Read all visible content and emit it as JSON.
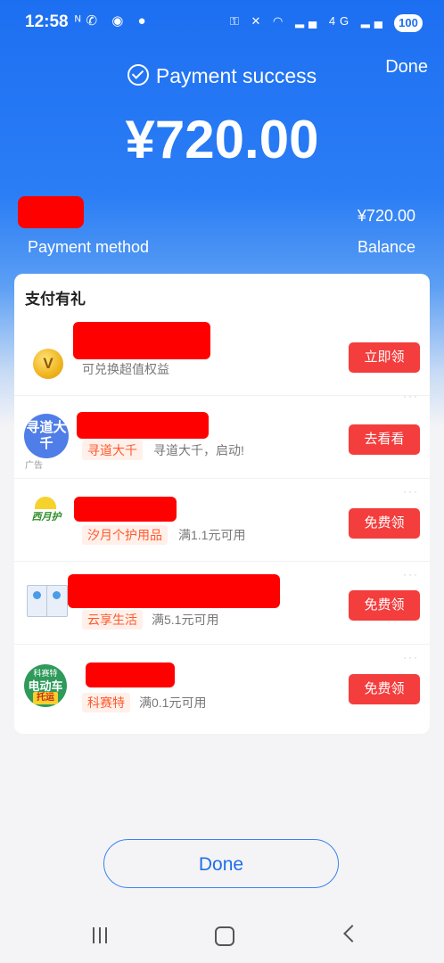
{
  "status_bar": {
    "time": "12:58",
    "left_icons": [
      "nfc-icon",
      "wechat-icon",
      "chat-icon",
      "dot-icon"
    ],
    "left_icons_glyph": "ᴺ✆ ◉ ●",
    "right_icons_glyph": "⚿ ✕ ◠ ▂▄ 4G ▂▄",
    "battery": "100"
  },
  "header": {
    "done_label": "Done",
    "success_text": "Payment success",
    "amount": "¥720.00",
    "balance_amount": "¥720.00",
    "payment_method_label": "Payment method",
    "balance_label": "Balance"
  },
  "card": {
    "title": "支付有礼",
    "items": [
      {
        "logo": "vip-coin-icon",
        "logo_text": "V",
        "tag": "",
        "desc": "可兑换超值权益",
        "button": "立即领"
      },
      {
        "logo": "xundao-daqian-logo",
        "logo_text": "寻道大千",
        "ad": "广告",
        "tag": "寻道大千",
        "desc": "寻道大千，启动!",
        "button": "去看看"
      },
      {
        "logo": "xiyue-logo",
        "logo_text": "西月护",
        "tag": "汐月个护用品",
        "desc": "满1.1元可用",
        "button": "免费领"
      },
      {
        "logo": "yunxiang-logo",
        "tag": "云享生活",
        "desc": "满5.1元可用",
        "button": "免费领"
      },
      {
        "logo": "kesaite-logo",
        "logo_l1": "科赛特",
        "logo_l2": "电动车",
        "logo_l3": "托运",
        "tag": "科赛特",
        "desc": "满0.1元可用",
        "button": "免费领"
      }
    ]
  },
  "footer": {
    "done_label": "Done"
  },
  "colors": {
    "primary_blue": "#1d6ff2",
    "button_red": "#f43d3d",
    "tag_orange": "#ff5a2e",
    "redaction": "#ff0000"
  }
}
